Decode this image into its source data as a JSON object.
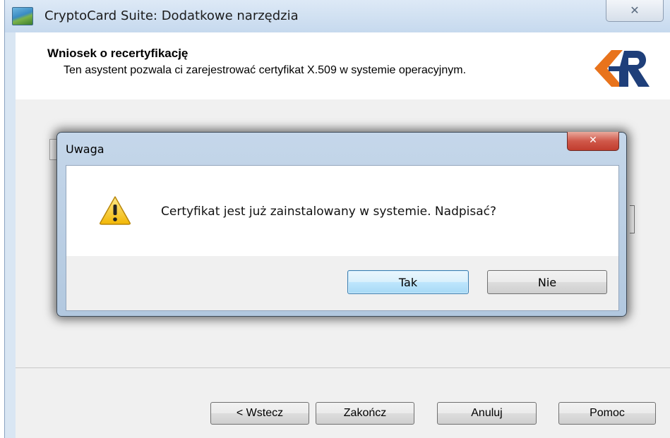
{
  "window": {
    "title": "CryptoCard Suite: Dodatkowe narzędzia",
    "close_glyph": "✕",
    "app_icon": "cryptocard-app-icon"
  },
  "wizard": {
    "header_title": "Wniosek o recertyfikację",
    "header_description": "Ten asystent pozwala ci zarejestrować certyfikat X.509 w systemie operacyjnym.",
    "logo": "kir-logo",
    "buttons": {
      "back": "< Wstecz",
      "finish": "Zakończ",
      "cancel": "Anuluj",
      "help": "Pomoc"
    }
  },
  "dialog": {
    "title": "Uwaga",
    "close_glyph": "✕",
    "icon": "warning-icon",
    "message": "Certyfikat jest już zainstalowany w systemie. Nadpisać?",
    "buttons": {
      "yes": "Tak",
      "no": "Nie"
    }
  },
  "colors": {
    "logo_orange": "#e8731c",
    "logo_blue": "#1f3f7a",
    "warning_yellow": "#f5c518",
    "close_red": "#c94a3c"
  }
}
